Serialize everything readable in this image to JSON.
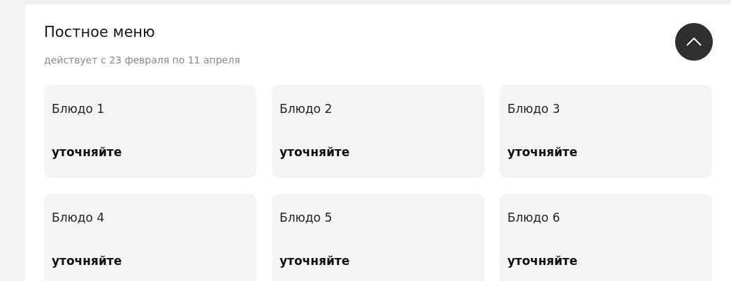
{
  "section": {
    "title": "Постное меню",
    "subtitle": "действует с 23 февраля по 11 апреля"
  },
  "dishes": [
    {
      "name": "Блюдо 1",
      "price": "уточняйте"
    },
    {
      "name": "Блюдо 2",
      "price": "уточняйте"
    },
    {
      "name": "Блюдо 3",
      "price": "уточняйте"
    },
    {
      "name": "Блюдо 4",
      "price": "уточняйте"
    },
    {
      "name": "Блюдо 5",
      "price": "уточняйте"
    },
    {
      "name": "Блюдо 6",
      "price": "уточняйте"
    }
  ]
}
